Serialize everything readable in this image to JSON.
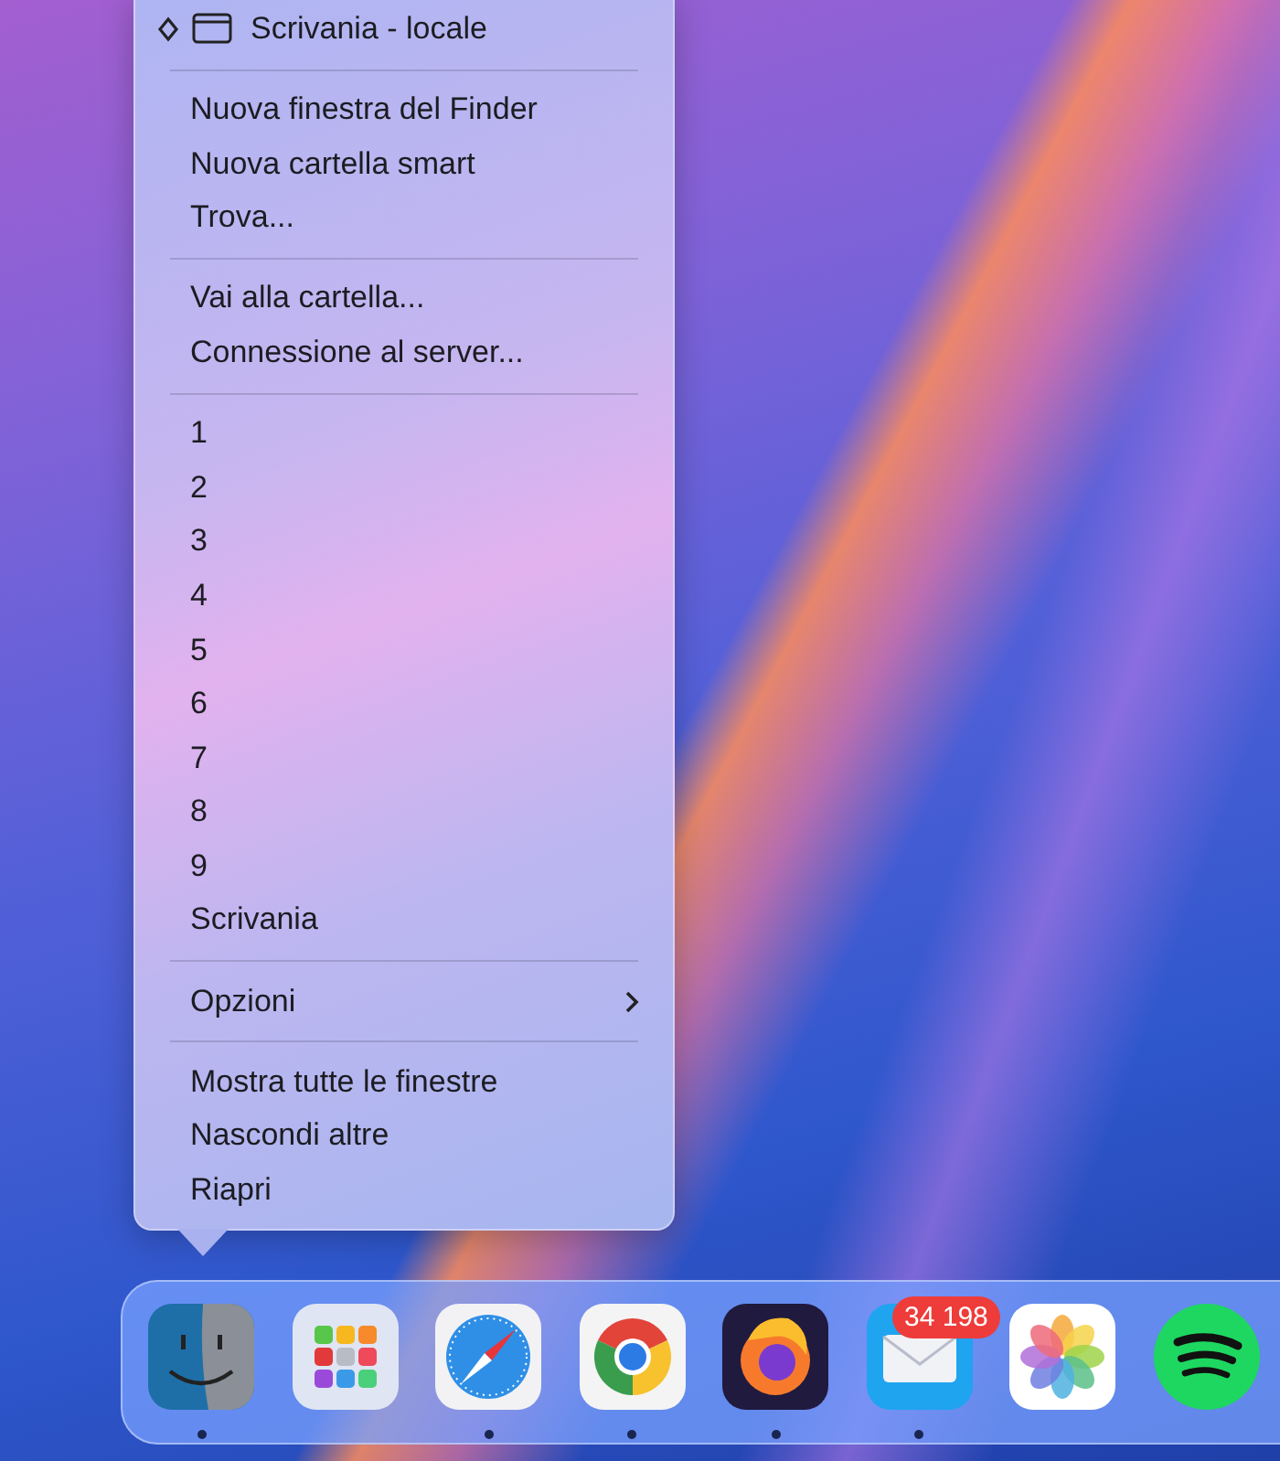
{
  "menu": {
    "header": {
      "title": "Scrivania - locale",
      "minimized": true
    },
    "sections": [
      [
        {
          "label": "Nuova finestra del Finder",
          "kind": "item"
        },
        {
          "label": "Nuova cartella smart",
          "kind": "item"
        },
        {
          "label": "Trova...",
          "kind": "item"
        }
      ],
      [
        {
          "label": "Vai alla cartella...",
          "kind": "item"
        },
        {
          "label": "Connessione al server...",
          "kind": "item"
        }
      ],
      [
        {
          "label": "1",
          "kind": "item"
        },
        {
          "label": "2",
          "kind": "item"
        },
        {
          "label": "3",
          "kind": "item"
        },
        {
          "label": "4",
          "kind": "item"
        },
        {
          "label": "5",
          "kind": "item"
        },
        {
          "label": "6",
          "kind": "item"
        },
        {
          "label": "7",
          "kind": "item"
        },
        {
          "label": "8",
          "kind": "item"
        },
        {
          "label": "9",
          "kind": "item"
        },
        {
          "label": "Scrivania",
          "kind": "item"
        }
      ],
      [
        {
          "label": "Opzioni",
          "kind": "submenu"
        }
      ],
      [
        {
          "label": "Mostra tutte le finestre",
          "kind": "item"
        },
        {
          "label": "Nascondi altre",
          "kind": "item"
        },
        {
          "label": "Riapri",
          "kind": "item"
        }
      ]
    ]
  },
  "dock": {
    "apps": [
      {
        "kind": "finder",
        "running": true
      },
      {
        "kind": "launchpad",
        "running": false
      },
      {
        "kind": "safari",
        "running": true
      },
      {
        "kind": "chrome",
        "running": true
      },
      {
        "kind": "firefox",
        "running": true
      },
      {
        "kind": "mail",
        "running": true,
        "badge": "34 198"
      },
      {
        "kind": "photos",
        "running": false
      },
      {
        "kind": "spotify",
        "running": false
      }
    ]
  }
}
